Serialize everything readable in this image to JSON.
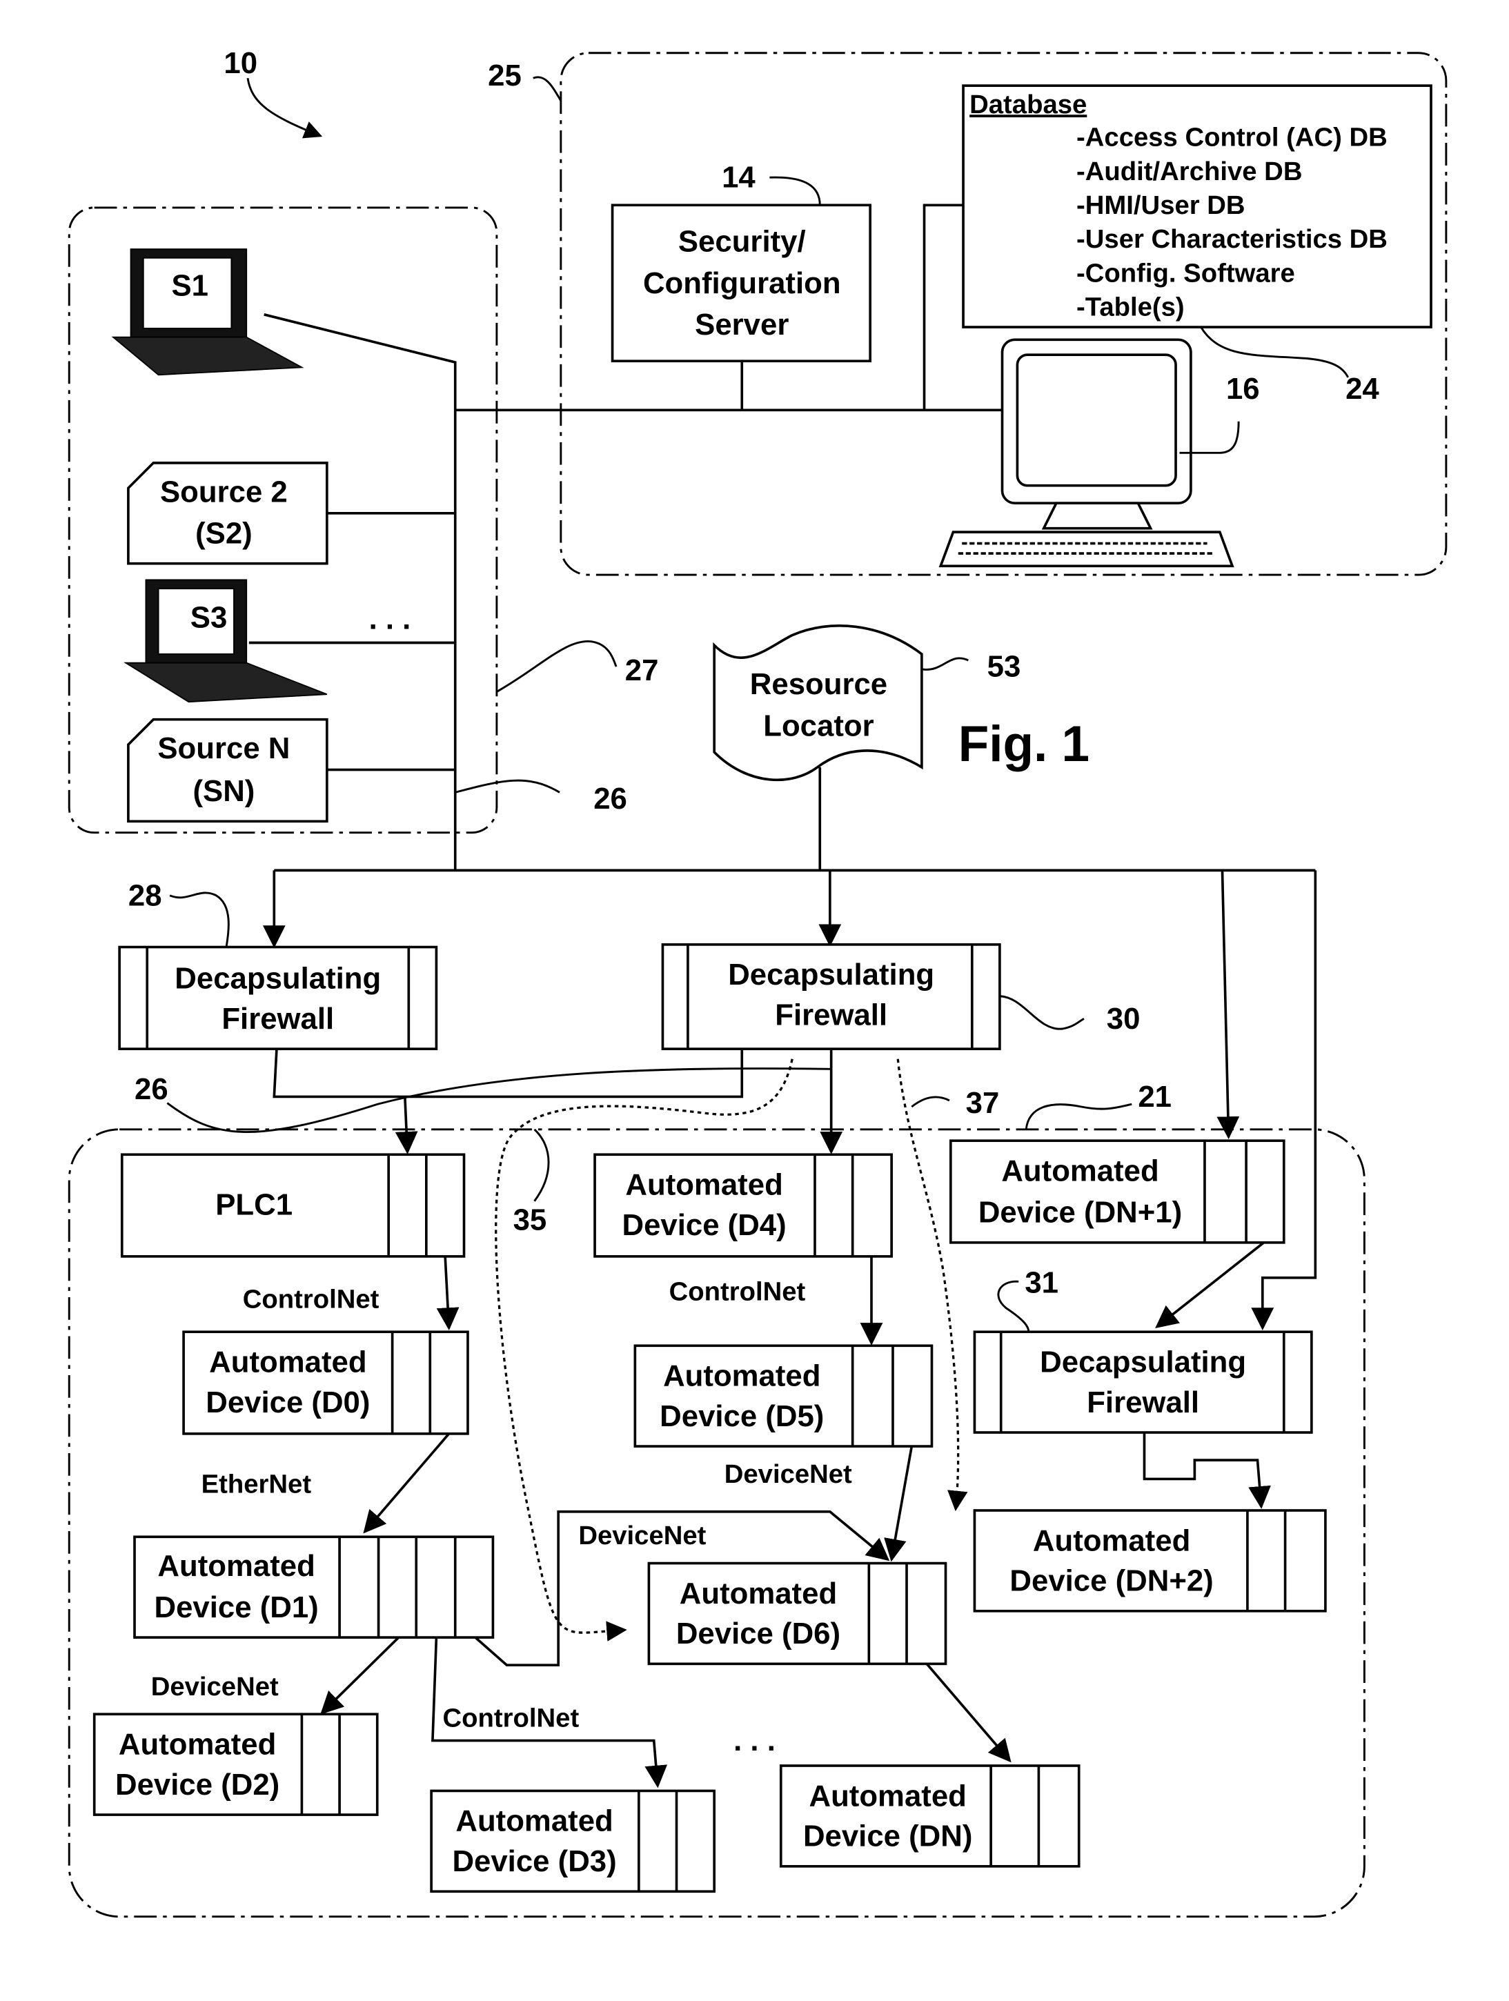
{
  "figure": {
    "label": "Fig. 1",
    "system_ref": "10"
  },
  "refs": {
    "r25": "25",
    "r14": "14",
    "r16": "16",
    "r24": "24",
    "r27": "27",
    "r26a": "26",
    "r26b": "26",
    "r53": "53",
    "r28": "28",
    "r30": "30",
    "r37": "37",
    "r21": "21",
    "r31": "31",
    "r35": "35"
  },
  "sources": {
    "s1": "S1",
    "s2": [
      "Source 2",
      "(S2)"
    ],
    "s3": "S3",
    "sn": [
      "Source N",
      "(SN)"
    ],
    "ellipsis": ". . ."
  },
  "server": {
    "lines": [
      "Security/",
      "Configuration",
      "Server"
    ]
  },
  "database": {
    "title": "Database",
    "items": [
      "-Access Control (AC) DB",
      "-Audit/Archive DB",
      "-HMI/User DB",
      "-User Characteristics DB",
      "-Config. Software",
      "-Table(s)"
    ]
  },
  "resource_locator": [
    "Resource",
    "Locator"
  ],
  "firewalls": {
    "f28": [
      "Decapsulating",
      "Firewall"
    ],
    "f30": [
      "Decapsulating",
      "Firewall"
    ],
    "f31": [
      "Decapsulating",
      "Firewall"
    ]
  },
  "devices": {
    "plc1": "PLC1",
    "d0": [
      "Automated",
      "Device (D0)"
    ],
    "d1": [
      "Automated",
      "Device (D1)"
    ],
    "d2": [
      "Automated",
      "Device (D2)"
    ],
    "d3": [
      "Automated",
      "Device (D3)"
    ],
    "d4": [
      "Automated",
      "Device (D4)"
    ],
    "d5": [
      "Automated",
      "Device (D5)"
    ],
    "d6": [
      "Automated",
      "Device (D6)"
    ],
    "dn": [
      "Automated",
      "Device (DN)"
    ],
    "dn1": [
      "Automated",
      "Device (DN+1)"
    ],
    "dn2": [
      "Automated",
      "Device (DN+2)"
    ]
  },
  "networks": {
    "plc_d0": "ControlNet",
    "d0_d1": "EtherNet",
    "d4_d5": "ControlNet",
    "d5_d6": "DeviceNet",
    "d1_d6": "DeviceNet",
    "d1_d2": "DeviceNet",
    "d1_d3": "ControlNet",
    "lower_ellipsis": ". . ."
  }
}
